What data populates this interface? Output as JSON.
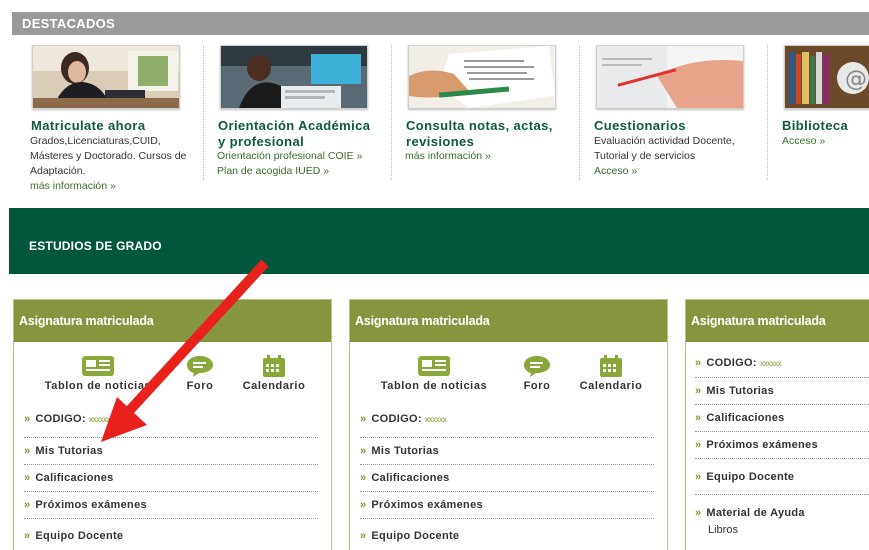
{
  "destacados": {
    "header": "DESTACADOS",
    "items": [
      {
        "title_lines": [
          "Matriculate ahora"
        ],
        "desc_lines": [
          "Grados,Licenciaturas,CUID,",
          "Másteres y Doctorado. Cursos de",
          "Adaptación."
        ],
        "links": [
          "más información »"
        ]
      },
      {
        "title_lines": [
          "Orientación Académica",
          "y profesional"
        ],
        "desc_lines": [],
        "links": [
          "Orientación profesional COIE »",
          "Plan de acogida IUED »"
        ]
      },
      {
        "title_lines": [
          "Consulta notas, actas,",
          "revisiones"
        ],
        "desc_lines": [],
        "links": [
          "más información »"
        ]
      },
      {
        "title_lines": [
          "Cuestionarios"
        ],
        "desc_lines": [
          "Evaluación actividad Docente,",
          "Tutorial y de servicios"
        ],
        "links": [
          "Acceso »"
        ]
      },
      {
        "title_lines": [
          "Biblioteca"
        ],
        "desc_lines": [],
        "links": [
          "Acceso »"
        ]
      }
    ]
  },
  "banner": {
    "label": "ESTUDIOS DE GRADO"
  },
  "panel_title": "Asignatura matriculada",
  "tools": {
    "tablon": "Tablon de noticias",
    "foro": "Foro",
    "calendario": "Calendario"
  },
  "menu": {
    "codigo_label": "CODIGO:",
    "codigo_value": "xxxxxx",
    "mis_tutorias": "Mis Tutorias",
    "calificaciones": "Calificaciones",
    "proximos": "Próximos exámenes",
    "equipo": "Equipo Docente",
    "material": "Material de Ayuda",
    "libros": "Libros"
  },
  "colors": {
    "banner_green": "#00573c",
    "panel_olive": "#86963f",
    "title_green": "#0e5a3a",
    "arrow_red": "#e8211c"
  },
  "annotation": {
    "type": "red-arrow",
    "pointing_to": "Mis Tutorias"
  }
}
